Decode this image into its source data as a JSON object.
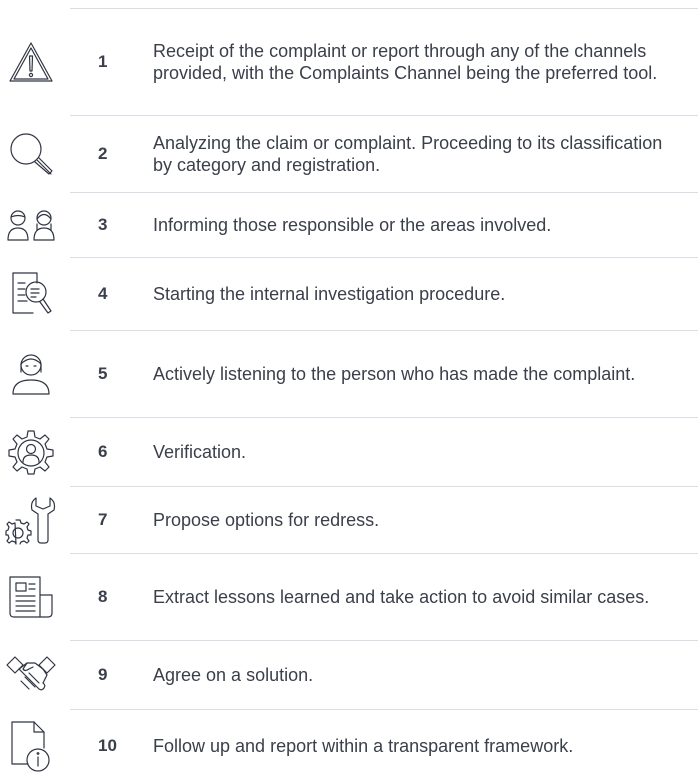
{
  "steps": [
    {
      "number": "1",
      "icon": "warning-icon",
      "text": "Receipt of the complaint or report through any of the channels provided, with the Complaints Channel being the preferred tool."
    },
    {
      "number": "2",
      "icon": "magnifier-icon",
      "text": "Analyzing the claim or complaint. Proceeding to its classification by category and registration."
    },
    {
      "number": "3",
      "icon": "two-people-icon",
      "text": "Informing those responsible or the areas involved."
    },
    {
      "number": "4",
      "icon": "document-search-icon",
      "text": "Starting the internal investigation procedure."
    },
    {
      "number": "5",
      "icon": "person-icon",
      "text": "Actively listening to the person who has made the complaint."
    },
    {
      "number": "6",
      "icon": "gear-person-icon",
      "text": "Verification."
    },
    {
      "number": "7",
      "icon": "gear-wrench-icon",
      "text": "Propose options for redress."
    },
    {
      "number": "8",
      "icon": "newspaper-icon",
      "text": "Extract lessons learned and take action to avoid similar cases."
    },
    {
      "number": "9",
      "icon": "handshake-icon",
      "text": "Agree on a solution."
    },
    {
      "number": "10",
      "icon": "document-info-icon",
      "text": "Follow up and report within a transparent framework."
    }
  ]
}
